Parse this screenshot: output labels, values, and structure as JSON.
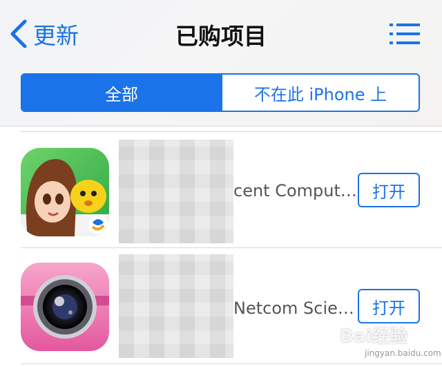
{
  "nav": {
    "back_label": "更新",
    "title": "已购项目"
  },
  "segments": {
    "all_label": "全部",
    "not_on_device_label": "不在此 iPhone 上"
  },
  "apps": [
    {
      "developer": "cent Comput…",
      "button_label": "打开"
    },
    {
      "developer": "Netcom Scie…",
      "button_label": "打开"
    }
  ],
  "watermark": {
    "brand": "Bai",
    "brand_suffix": "经验",
    "url": "jingyan.baidu.com"
  },
  "colors": {
    "accent": "#1a73e8",
    "separator": "#d8d8dc"
  },
  "icons": {
    "back": "chevron-left-icon",
    "menu": "list-icon"
  }
}
